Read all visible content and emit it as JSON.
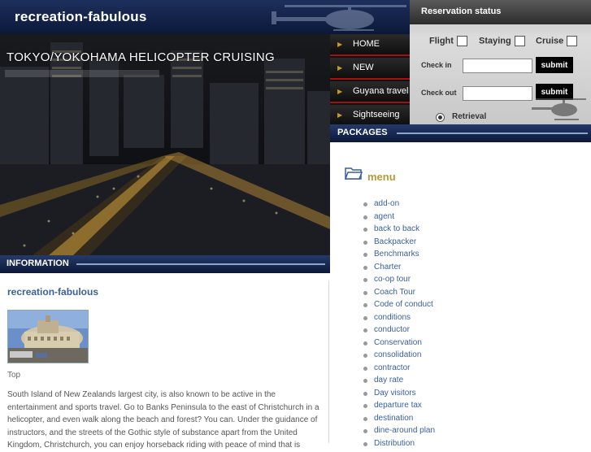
{
  "header": {
    "site_title": "recreation-fabulous"
  },
  "hero": {
    "heading": "TOKYO/YOKOHAMA  HELICOPTER CRUISING"
  },
  "nav": {
    "items": [
      {
        "label": "HOME"
      },
      {
        "label": "NEW"
      },
      {
        "label": "Guyana travel"
      },
      {
        "label": "Sightseeing"
      }
    ]
  },
  "reservation": {
    "title": "Reservation status",
    "options": [
      "Flight",
      "Staying",
      "Cruise"
    ],
    "check_in_label": "Check in",
    "check_out_label": "Check out",
    "submit_label": "submit",
    "retrieval_label": "Retrieval"
  },
  "packages": {
    "label": "PACKAGES"
  },
  "information": {
    "label": "INFORMATION",
    "title": "recreation-fabulous",
    "top_label": "Top",
    "body": "South Island of New Zealands largest city, is also known to be active in the entertainment and sports travel. Go to Banks Peninsula to the east of Christchurch in a helicopter, and even walk along the beach and forest? You can. Under the guidance of instructors, and the streets of the Gothic style of substance apart from the United Kingdom, Christchurch, you can enjoy horseback riding with peace of mind that is"
  },
  "menu": {
    "heading": "menu",
    "items": [
      "add-on",
      "agent",
      "back to back",
      "Backpacker",
      "Benchmarks",
      "Charter",
      "co-op tour",
      "Coach Tour",
      "Code of conduct",
      "conditions",
      "conductor",
      "Conservation",
      "consolidation",
      "contractor",
      "day rate",
      "Day visitors",
      "departure tax",
      "destination",
      "dine-around plan",
      "Distribution"
    ]
  },
  "colors": {
    "header_navy": "#0b1838",
    "link_blue": "#3a5f9e",
    "menu_gold": "#b59a3a",
    "nav_red": "#a01212"
  }
}
